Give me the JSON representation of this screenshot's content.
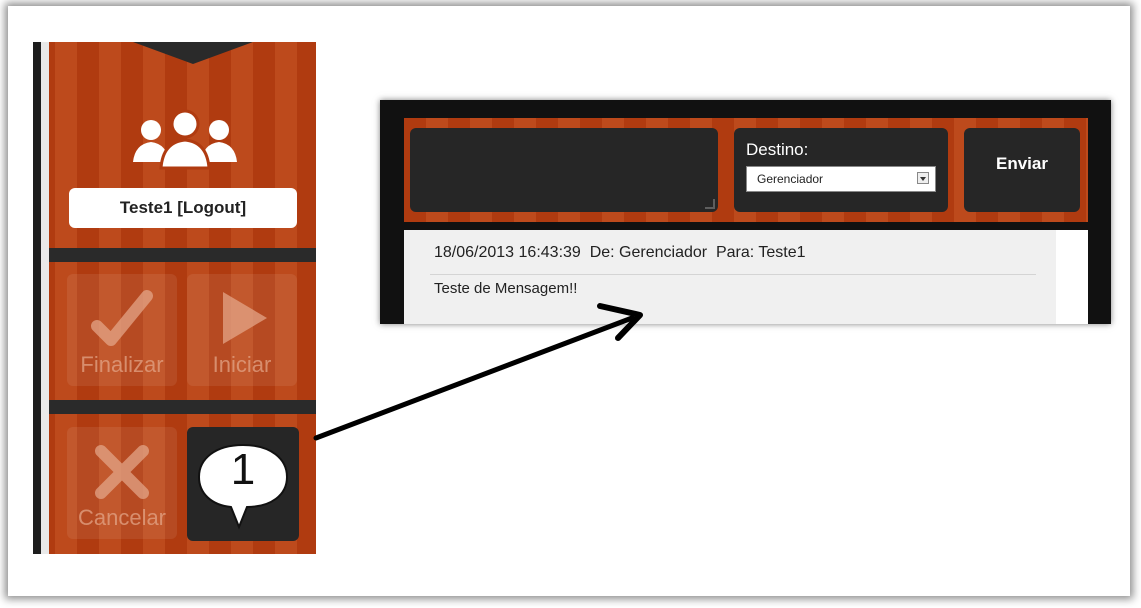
{
  "sidebar": {
    "user_button_label": "Teste1 [Logout]",
    "actions": [
      {
        "label": "Finalizar",
        "icon": "checkmark-icon"
      },
      {
        "label": "Iniciar",
        "icon": "play-icon"
      },
      {
        "label": "Cancelar",
        "icon": "x-icon"
      }
    ],
    "message_count": "1",
    "colors": {
      "accent": "#b03b10",
      "dark": "#262626"
    }
  },
  "chat": {
    "destination_label": "Destino:",
    "destination_selected": "Gerenciador",
    "send_label": "Enviar",
    "message": {
      "header": "18/06/2013 16:43:39  De: Gerenciador  Para: Teste1",
      "body": "Teste de Mensagem!!"
    }
  }
}
